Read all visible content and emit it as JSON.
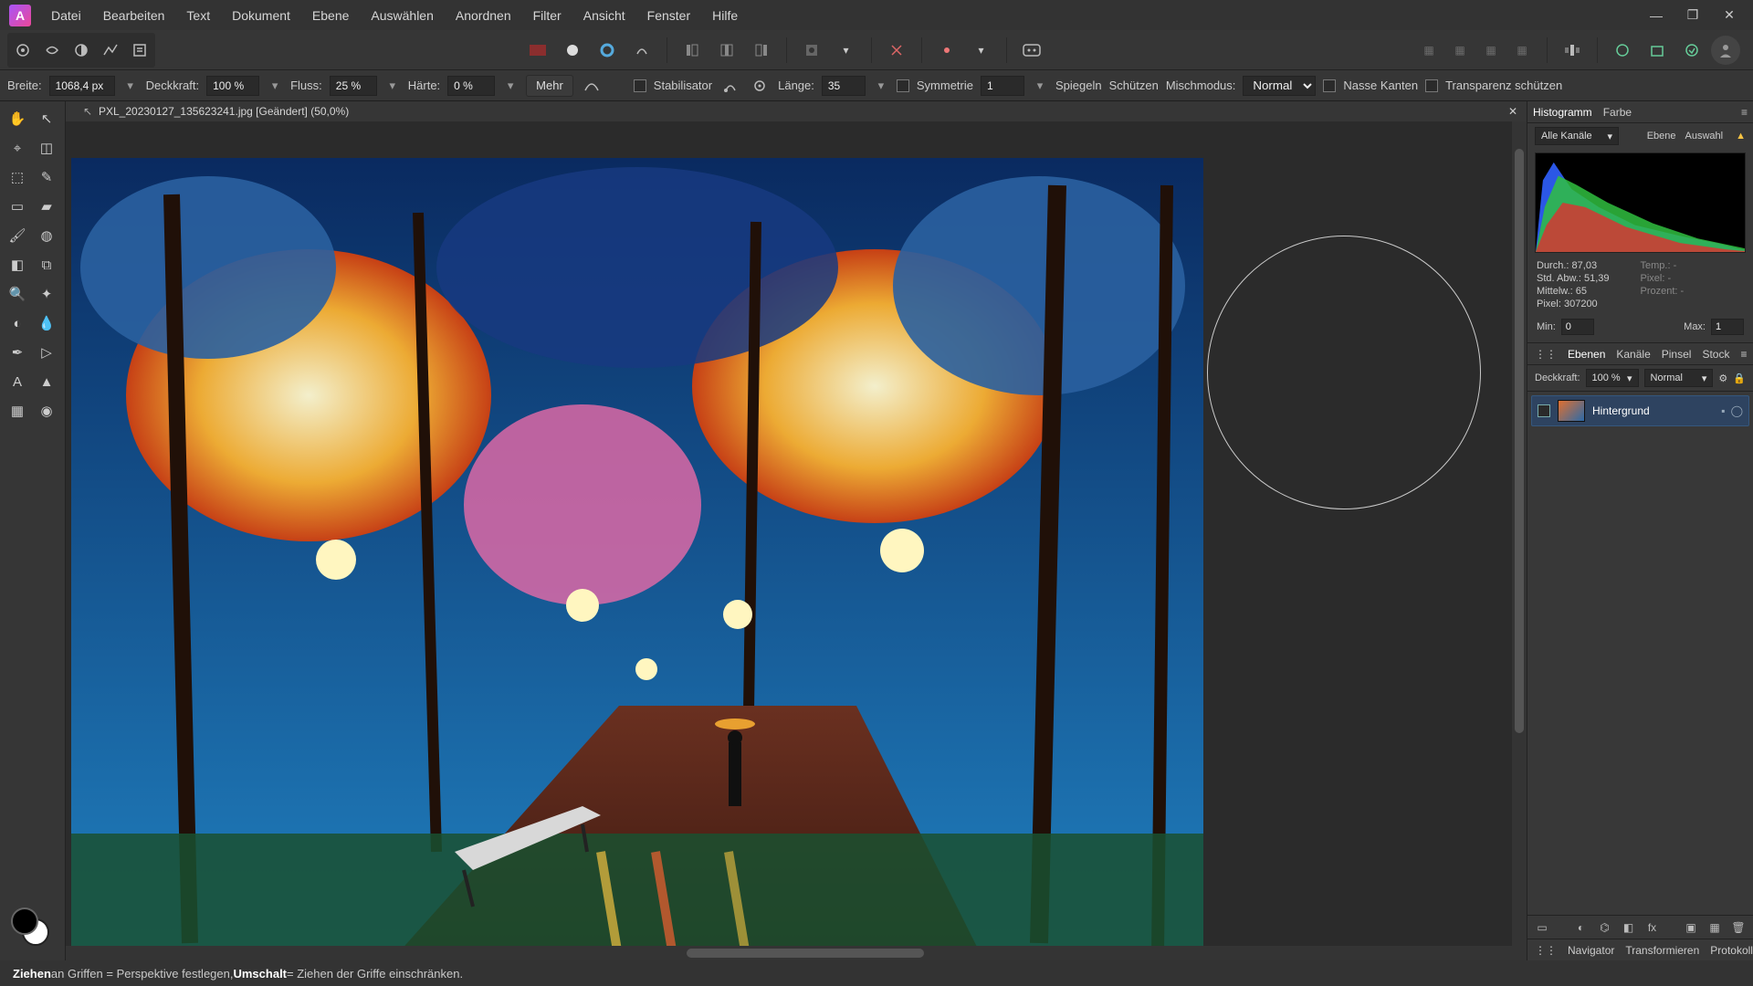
{
  "menubar": {
    "items": [
      "Datei",
      "Bearbeiten",
      "Text",
      "Dokument",
      "Ebene",
      "Auswählen",
      "Anordnen",
      "Filter",
      "Ansicht",
      "Fenster",
      "Hilfe"
    ]
  },
  "window": {
    "min": "—",
    "max": "❐",
    "close": "✕"
  },
  "context": {
    "breite_label": "Breite:",
    "breite": "1068,4 px",
    "deck_label": "Deckkraft:",
    "deck": "100 %",
    "fluss_label": "Fluss:",
    "fluss": "25 %",
    "haerte_label": "Härte:",
    "haerte": "0 %",
    "mehr": "Mehr",
    "stab_label": "Stabilisator",
    "laenge_label": "Länge:",
    "laenge": "35",
    "sym_label": "Symmetrie",
    "sym_val": "1",
    "spiegeln": "Spiegeln",
    "schuetzen": "Schützen",
    "misch_label": "Mischmodus:",
    "misch_val": "Normal",
    "nasse": "Nasse Kanten",
    "transp": "Transparenz schützen"
  },
  "doc": {
    "title": "PXL_20230127_135623241.jpg [Geändert] (50,0%)"
  },
  "histogram": {
    "tab1": "Histogramm",
    "tab2": "Farbe",
    "channels": "Alle Kanäle",
    "ebene": "Ebene",
    "auswahl": "Auswahl",
    "stats": {
      "durch_l": "Durch.:",
      "durch": "87,03",
      "temp_l": "Temp.:",
      "temp": "-",
      "std_l": "Std. Abw.:",
      "std": "51,39",
      "pixl_l": "Pixel:",
      "pixl": "-",
      "mittel_l": "Mittelw.:",
      "mittel": "65",
      "proz_l": "Prozent:",
      "proz": "-",
      "pixel_l": "Pixel:",
      "pixel": "307200"
    },
    "min_l": "Min:",
    "min": "0",
    "max_l": "Max:",
    "max": "1"
  },
  "layers_panel": {
    "tabs": [
      "Ebenen",
      "Kanäle",
      "Pinsel",
      "Stock"
    ],
    "deck_l": "Deckkraft:",
    "deck": "100 %",
    "blend": "Normal",
    "layer_name": "Hintergrund"
  },
  "bottom_tabs": [
    "Navigator",
    "Transformieren",
    "Protokoll"
  ],
  "status": {
    "a": "Ziehen",
    "b": " an Griffen = Perspektive festlegen, ",
    "c": "Umschalt",
    "d": " = Ziehen der Griffe einschränken."
  }
}
